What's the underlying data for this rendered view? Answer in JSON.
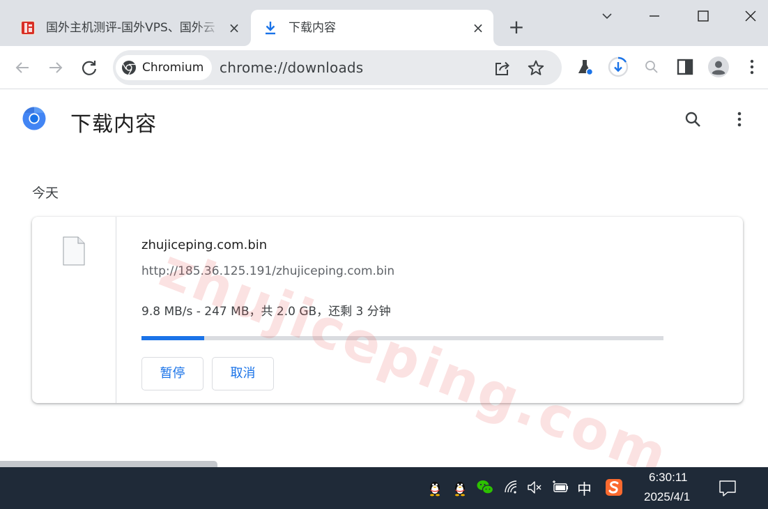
{
  "tabs": [
    {
      "title": "国外主机测评-国外VPS、国外云",
      "close": "×",
      "active": false
    },
    {
      "title": "下载内容",
      "close": "×",
      "active": true
    }
  ],
  "new_tab": "+",
  "omnibox": {
    "site_chip": "Chromium",
    "url": "chrome://downloads"
  },
  "page": {
    "title": "下载内容",
    "section": "今天"
  },
  "download": {
    "file_name": "zhujiceping.com.bin",
    "url": "http://185.36.125.191/zhujiceping.com.bin",
    "status": "9.8 MB/s - 247 MB，共 2.0 GB，还剩 3 分钟",
    "progress": 0.12,
    "pause_label": "暂停",
    "cancel_label": "取消"
  },
  "watermark": "zhujiceping.com",
  "taskbar": {
    "ime": "中",
    "time": "6:30:11",
    "date": "2025/4/1"
  },
  "colors": {
    "accent": "#1a73e8",
    "tabstrip": "#dee1e6",
    "taskbar": "#1f2a38"
  }
}
